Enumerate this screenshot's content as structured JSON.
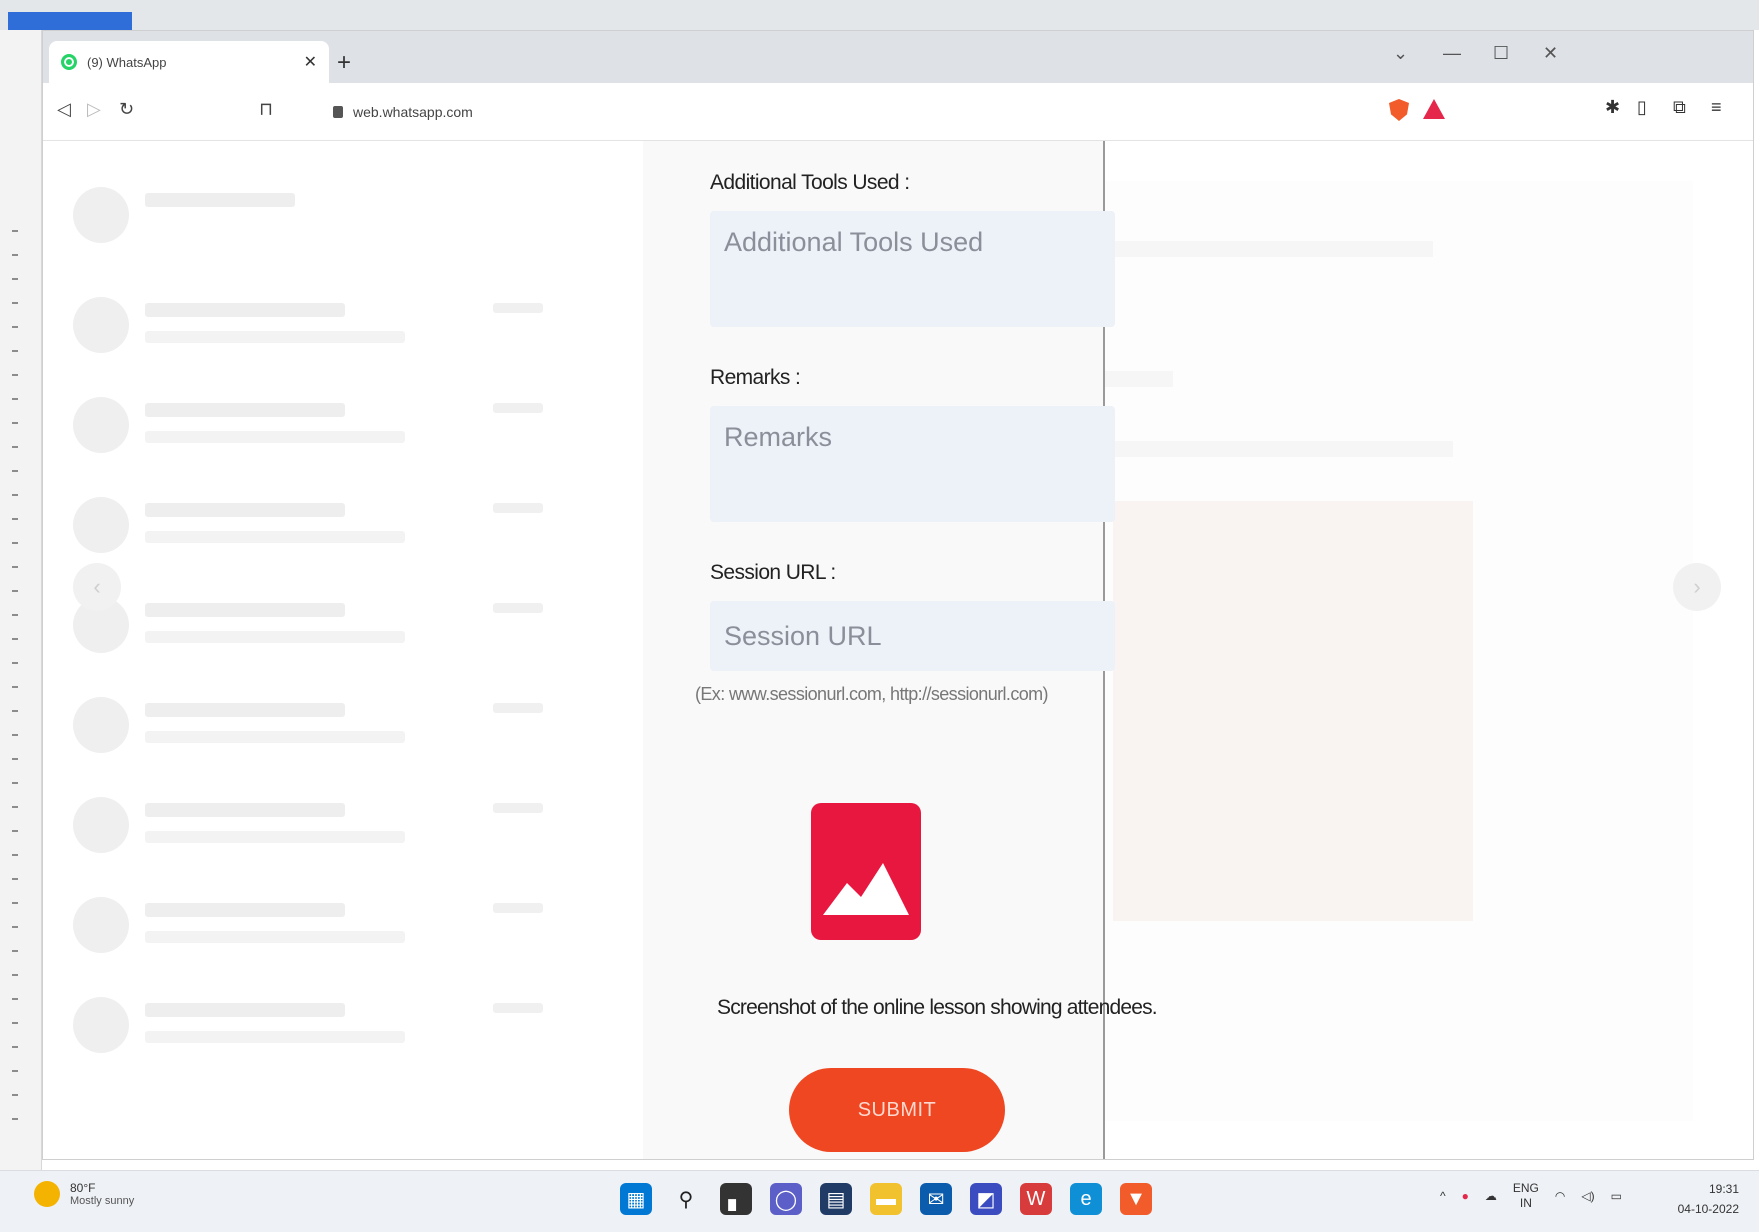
{
  "browser": {
    "tab_title": "(9) WhatsApp",
    "url": "web.whatsapp.com"
  },
  "form": {
    "tools_label": "Additional Tools Used :",
    "tools_placeholder": "Additional Tools Used",
    "remarks_label": "Remarks :",
    "remarks_placeholder": "Remarks",
    "session_label": "Session URL :",
    "session_placeholder": "Session URL",
    "session_hint": "(Ex: www.sessionurl.com, http://sessionurl.com)",
    "image_caption": "Screenshot of the online lesson showing attendees.",
    "submit_label": "SUBMIT"
  },
  "colors": {
    "accent": "#ef4722",
    "image_icon": "#e8173f",
    "field_bg": "#edf1f8"
  },
  "taskbar": {
    "weather_temp": "80°F",
    "weather_condition": "Mostly sunny",
    "lang_top": "ENG",
    "lang_bottom": "IN",
    "time": "19:31",
    "date": "04-10-2022",
    "icons": [
      "start-icon",
      "search-icon",
      "file-explorer-icon",
      "chat-icon",
      "calendar-icon",
      "folder-icon",
      "mail-icon",
      "app-icon",
      "office-icon",
      "edge-icon",
      "brave-icon"
    ]
  }
}
